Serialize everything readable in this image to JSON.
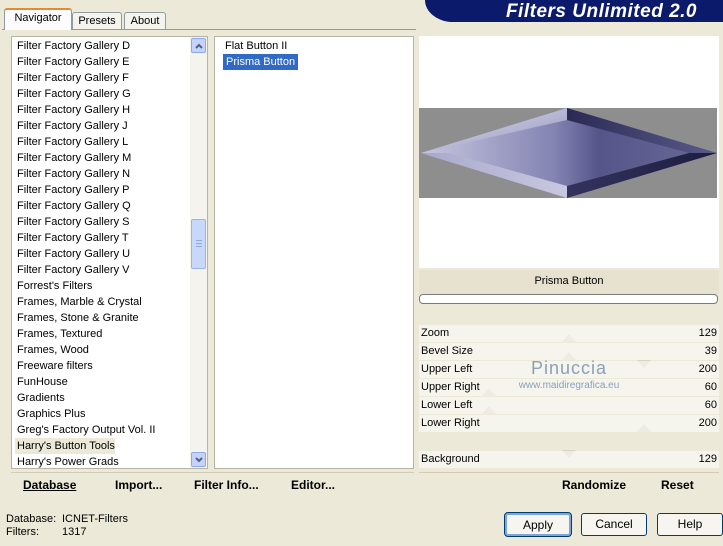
{
  "tabs": [
    {
      "label": "Navigator",
      "active": true
    },
    {
      "label": "Presets",
      "active": false
    },
    {
      "label": "About",
      "active": false
    }
  ],
  "banner_title": "Filters Unlimited 2.0",
  "categories": [
    "Filter Factory Gallery D",
    "Filter Factory Gallery E",
    "Filter Factory Gallery F",
    "Filter Factory Gallery G",
    "Filter Factory Gallery H",
    "Filter Factory Gallery J",
    "Filter Factory Gallery L",
    "Filter Factory Gallery M",
    "Filter Factory Gallery N",
    "Filter Factory Gallery P",
    "Filter Factory Gallery Q",
    "Filter Factory Gallery S",
    "Filter Factory Gallery T",
    "Filter Factory Gallery U",
    "Filter Factory Gallery V",
    "Forrest's Filters",
    "Frames, Marble & Crystal",
    "Frames, Stone & Granite",
    "Frames, Textured",
    "Frames, Wood",
    "Freeware filters",
    "FunHouse",
    "Gradients",
    "Graphics Plus",
    "Greg's Factory Output Vol. II",
    "Harry's Button Tools",
    "Harry's Power Grads"
  ],
  "selected_category": "Harry's Button Tools",
  "filters": [
    "Flat Button II",
    "Prisma Button"
  ],
  "selected_filter": "Prisma Button",
  "left_buttons": {
    "database": "Database",
    "import": "Import...",
    "filter_info": "Filter Info...",
    "editor": "Editor..."
  },
  "preview_name": "Prisma Button",
  "params": [
    {
      "label": "Zoom",
      "value": "129"
    },
    {
      "label": "Bevel Size",
      "value": "39"
    },
    {
      "label": "Upper Left",
      "value": "200"
    },
    {
      "label": "Upper Right",
      "value": "60"
    },
    {
      "label": "Lower Left",
      "value": "60"
    },
    {
      "label": "Lower Right",
      "value": "200"
    },
    {
      "label": "Background",
      "value": "129"
    }
  ],
  "watermark": {
    "line1": "Pinuccia",
    "line2": "www.maidiregrafica.eu"
  },
  "right_buttons": {
    "randomize": "Randomize",
    "reset": "Reset"
  },
  "status": {
    "database_label": "Database:",
    "database_value": "ICNET-Filters",
    "filters_label": "Filters:",
    "filters_value": "1317"
  },
  "dialog_buttons": {
    "apply": "Apply",
    "cancel": "Cancel",
    "help": "Help"
  }
}
